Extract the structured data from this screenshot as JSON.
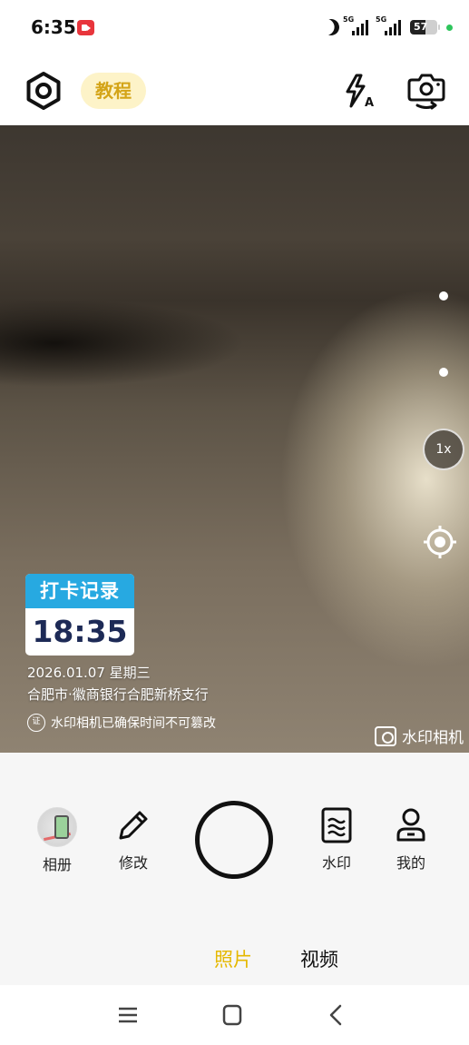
{
  "status_bar": {
    "time": "6:35",
    "signal_1_label": "5G",
    "signal_2_label": "5G",
    "battery": "57",
    "icons": [
      "screen-record-icon",
      "moon-icon",
      "signal-icon",
      "battery-icon"
    ]
  },
  "toolbar": {
    "tutorial_label": "教程",
    "icons": [
      "settings-icon",
      "flash-auto-icon",
      "camera-flip-icon"
    ]
  },
  "viewfinder": {
    "zoom_label": "1x",
    "focus_icon": "target-icon"
  },
  "watermark": {
    "header": "打卡记录",
    "clock": "18:35",
    "date_line": "2026.01.07  星期三",
    "location_line": "合肥市·徽商银行合肥新桥支行",
    "verify_badge": "证",
    "verify_text": "水印相机已确保时间不可篡改",
    "brand": "水印相机"
  },
  "controls": {
    "album_label": "相册",
    "edit_label": "修改",
    "watermark_label": "水印",
    "me_label": "我的"
  },
  "modes": {
    "photo": "照片",
    "video": "视频",
    "active": "photo"
  },
  "colors": {
    "accent_yellow": "#e5b800",
    "tutorial_bg": "#fdf3c8",
    "watermark_blue": "#27a9e1",
    "clock_navy": "#1d2a56"
  },
  "nav_bar": {
    "icons": [
      "menu-icon",
      "home-icon",
      "back-icon"
    ]
  }
}
